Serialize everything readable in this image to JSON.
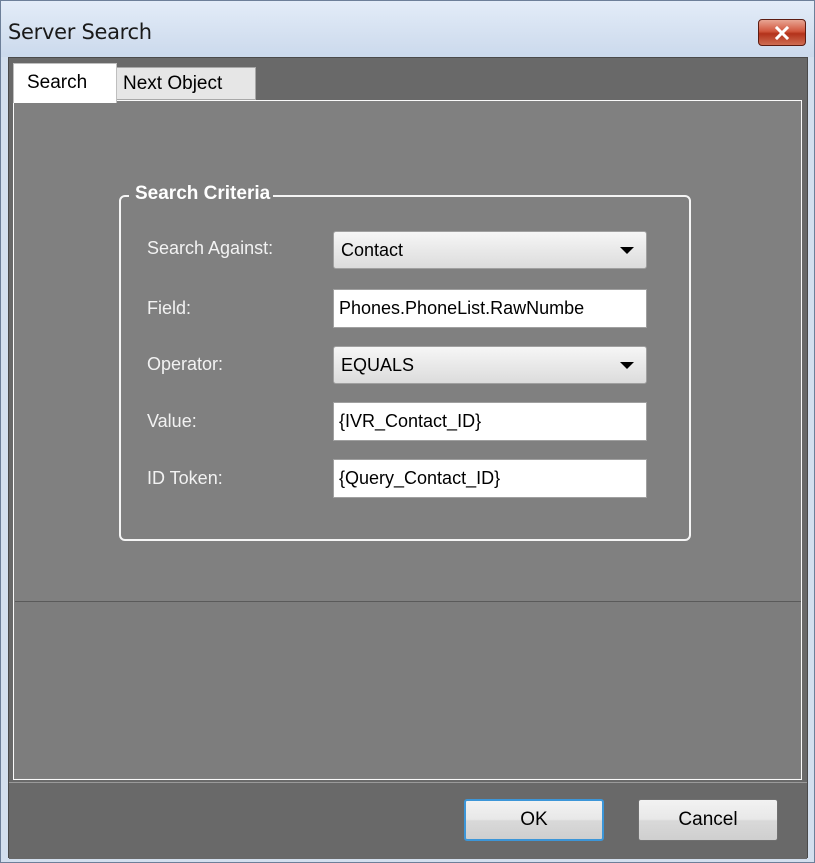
{
  "window": {
    "title": "Server Search"
  },
  "tabs": [
    {
      "label": "Search"
    },
    {
      "label": "Next Object"
    }
  ],
  "group": {
    "title": "Search Criteria",
    "search_against": {
      "label": "Search Against:",
      "value": "Contact"
    },
    "field": {
      "label": "Field:",
      "value": "Phones.PhoneList.RawNumbe"
    },
    "operator": {
      "label": "Operator:",
      "value": "EQUALS"
    },
    "value": {
      "label": "Value:",
      "value": "{IVR_Contact_ID}"
    },
    "id_token": {
      "label": "ID Token:",
      "value": "{Query_Contact_ID}"
    }
  },
  "buttons": {
    "ok": "OK",
    "cancel": "Cancel"
  },
  "colors": {
    "close_button": "#c8472e",
    "default_button_border": "#3c96d8"
  },
  "icons": {
    "close": "close-x-icon",
    "dropdown": "chevron-down-icon"
  }
}
